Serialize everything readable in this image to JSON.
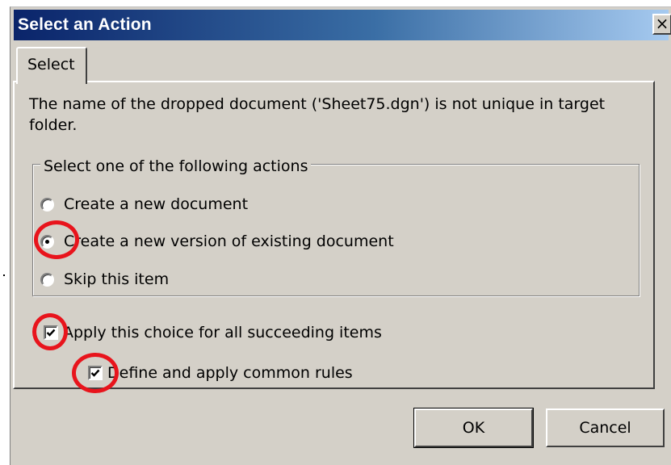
{
  "window": {
    "title": "Select an Action",
    "close_label": "×"
  },
  "tabs": [
    {
      "label": "Select",
      "active": true
    }
  ],
  "message": "The name of the dropped document ('Sheet75.dgn') is not unique in target folder.",
  "action_group": {
    "legend": "Select one of the following actions",
    "options": [
      {
        "label": "Create a new document",
        "selected": false
      },
      {
        "label": "Create a new version of existing document",
        "selected": true
      },
      {
        "label": "Skip this item",
        "selected": false
      }
    ]
  },
  "checkboxes": {
    "apply_all": {
      "label": "Apply this choice for all succeeding items",
      "checked": true
    },
    "common_rules": {
      "label": "Define and apply common rules",
      "checked": true
    }
  },
  "buttons": {
    "ok": "OK",
    "cancel": "Cancel"
  },
  "colors": {
    "title_start": "#0a246a",
    "title_end": "#a6caf0",
    "dialog_face": "#d4d0c8",
    "highlight": "#e8141c"
  }
}
